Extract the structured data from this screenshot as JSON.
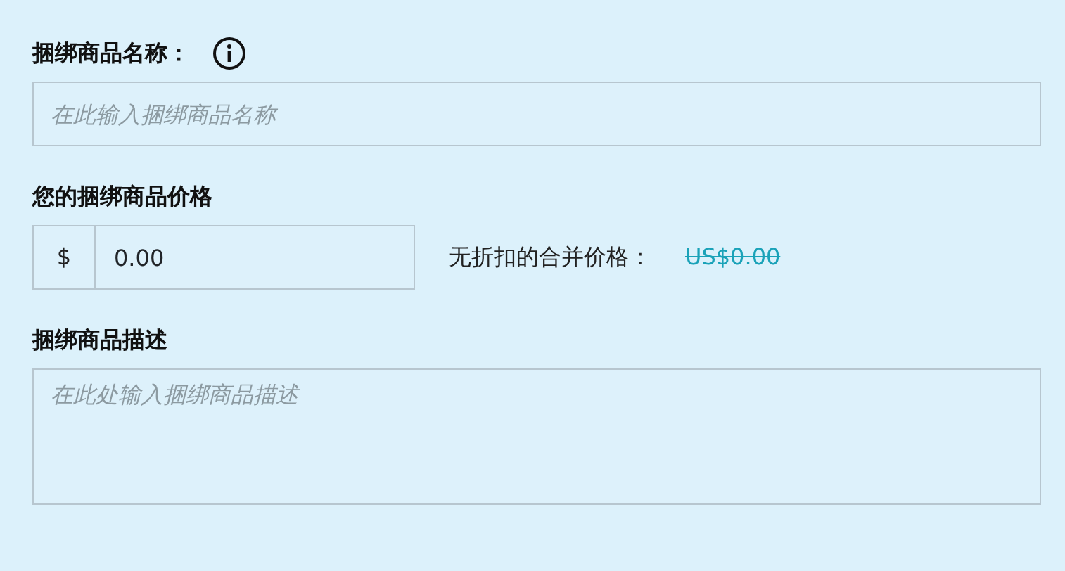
{
  "name_field": {
    "label": "捆绑商品名称：",
    "placeholder": "在此输入捆绑商品名称"
  },
  "price_field": {
    "label": "您的捆绑商品价格",
    "prefix": "$",
    "value": "0.00",
    "combined_label": "无折扣的合并价格：",
    "combined_value": "US$0.00",
    "struck": true
  },
  "description_field": {
    "label": "捆绑商品描述",
    "placeholder": "在此处输入捆绑商品描述"
  }
}
